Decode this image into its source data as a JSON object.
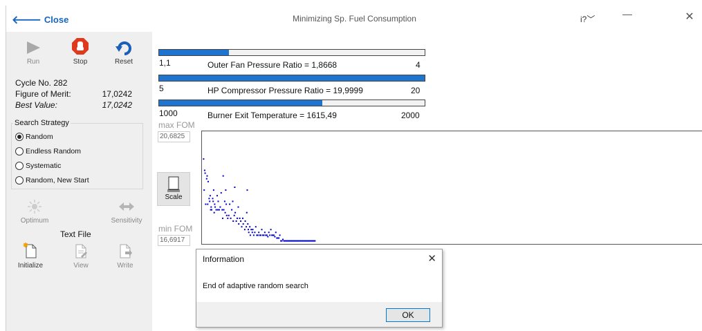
{
  "titlebar": {
    "back_label": "Close",
    "title": "Minimizing Sp. Fuel Consumption",
    "help": "i?",
    "min": "—",
    "close": "✕"
  },
  "toolbar": {
    "run": "Run",
    "stop": "Stop",
    "reset": "Reset"
  },
  "status": {
    "cycle": "Cycle No. 282",
    "fom_label": "Figure of Merit:",
    "fom_value": "17,0242",
    "best_label": "Best Value:",
    "best_value": "17,0242"
  },
  "search_strategy": {
    "legend": "Search Strategy",
    "options": [
      "Random",
      "Endless Random",
      "Systematic",
      "Random, New Start"
    ],
    "selected": "Random"
  },
  "tools": {
    "optimum": "Optimum",
    "sensitivity": "Sensitivity",
    "text_file": "Text File",
    "initialize": "Initialize",
    "view": "View",
    "write": "Write"
  },
  "params": [
    {
      "min": "1,1",
      "label": "Outer Fan Pressure Ratio = 1,8668",
      "max": "4",
      "fill": 0.263
    },
    {
      "min": "5",
      "label": "HP Compressor Pressure Ratio = 19,9999",
      "max": "20",
      "fill": 1.0
    },
    {
      "min": "1000",
      "label": "Burner Exit Temperature = 1615,49",
      "max": "2000",
      "fill": 0.615
    }
  ],
  "plot": {
    "max_label": "max FOM",
    "max_value": "20,6825",
    "min_label": "min FOM",
    "min_value": "16,6917",
    "scale": "Scale"
  },
  "dialog": {
    "title": "Information",
    "message": "End of adaptive random search",
    "ok": "OK"
  },
  "chart_data": {
    "type": "scatter",
    "title": "",
    "xlabel": "",
    "ylabel": "",
    "ylim": [
      16.6917,
      20.6825
    ],
    "xlim": [
      0,
      1000
    ],
    "color": "#0000cc",
    "points": [
      [
        2,
        19.7
      ],
      [
        3,
        18.6
      ],
      [
        4,
        19.3
      ],
      [
        5,
        19.2
      ],
      [
        6,
        18.1
      ],
      [
        8,
        19.0
      ],
      [
        9,
        19.1
      ],
      [
        10,
        18.1
      ],
      [
        11,
        18.9
      ],
      [
        13,
        18.3
      ],
      [
        14,
        18.2
      ],
      [
        15,
        18.4
      ],
      [
        16,
        17.9
      ],
      [
        17,
        18.0
      ],
      [
        18,
        17.9
      ],
      [
        20,
        18.3
      ],
      [
        21,
        18.2
      ],
      [
        22,
        18.6
      ],
      [
        23,
        17.8
      ],
      [
        24,
        18.1
      ],
      [
        25,
        18.0
      ],
      [
        27,
        17.9
      ],
      [
        29,
        18.4
      ],
      [
        30,
        17.9
      ],
      [
        31,
        18.2
      ],
      [
        33,
        17.9
      ],
      [
        35,
        18.0
      ],
      [
        37,
        18.5
      ],
      [
        39,
        17.9
      ],
      [
        40,
        17.6
      ],
      [
        41,
        19.1
      ],
      [
        42,
        17.9
      ],
      [
        44,
        18.2
      ],
      [
        45,
        17.8
      ],
      [
        46,
        18.6
      ],
      [
        47,
        18.1
      ],
      [
        48,
        17.7
      ],
      [
        50,
        17.6
      ],
      [
        52,
        17.7
      ],
      [
        54,
        18.1
      ],
      [
        56,
        17.6
      ],
      [
        58,
        17.9
      ],
      [
        60,
        18.2
      ],
      [
        61,
        17.5
      ],
      [
        63,
        17.7
      ],
      [
        64,
        18.7
      ],
      [
        65,
        17.8
      ],
      [
        67,
        17.5
      ],
      [
        69,
        17.6
      ],
      [
        71,
        18.0
      ],
      [
        72,
        17.4
      ],
      [
        74,
        17.6
      ],
      [
        76,
        17.5
      ],
      [
        78,
        17.3
      ],
      [
        80,
        17.6
      ],
      [
        81,
        17.4
      ],
      [
        84,
        17.2
      ],
      [
        85,
        17.5
      ],
      [
        87,
        17.3
      ],
      [
        88,
        17.8
      ],
      [
        89,
        18.6
      ],
      [
        90,
        17.4
      ],
      [
        91,
        17.2
      ],
      [
        92,
        17.1
      ],
      [
        94,
        17.3
      ],
      [
        95,
        17.0
      ],
      [
        97,
        17.2
      ],
      [
        99,
        17.1
      ],
      [
        100,
        17.2
      ],
      [
        102,
        17.0
      ],
      [
        104,
        17.1
      ],
      [
        106,
        17.3
      ],
      [
        108,
        17.0
      ],
      [
        110,
        17.0
      ],
      [
        112,
        17.1
      ],
      [
        114,
        17.0
      ],
      [
        116,
        17.0
      ],
      [
        118,
        17.2
      ],
      [
        120,
        17.0
      ],
      [
        122,
        17.0
      ],
      [
        124,
        17.1
      ],
      [
        126,
        17.0
      ],
      [
        128,
        17.0
      ],
      [
        130,
        16.95
      ],
      [
        132,
        17.1
      ],
      [
        134,
        17.0
      ],
      [
        136,
        17.2
      ],
      [
        138,
        17.0
      ],
      [
        140,
        17.0
      ],
      [
        142,
        17.0
      ],
      [
        144,
        16.95
      ],
      [
        146,
        17.1
      ],
      [
        148,
        16.9
      ],
      [
        150,
        16.9
      ],
      [
        152,
        16.9
      ],
      [
        154,
        17.0
      ],
      [
        156,
        16.8
      ],
      [
        158,
        16.8
      ],
      [
        160,
        16.85
      ],
      [
        162,
        16.8
      ],
      [
        164,
        16.8
      ],
      [
        166,
        16.8
      ],
      [
        168,
        16.8
      ],
      [
        170,
        16.8
      ],
      [
        172,
        16.8
      ],
      [
        174,
        16.8
      ],
      [
        176,
        16.8
      ],
      [
        178,
        16.8
      ],
      [
        180,
        16.8
      ],
      [
        182,
        16.8
      ],
      [
        184,
        16.8
      ],
      [
        186,
        16.8
      ],
      [
        188,
        16.8
      ],
      [
        190,
        16.8
      ],
      [
        192,
        16.8
      ],
      [
        194,
        16.8
      ],
      [
        196,
        16.8
      ],
      [
        198,
        16.8
      ],
      [
        200,
        16.8
      ],
      [
        202,
        16.8
      ],
      [
        204,
        16.8
      ],
      [
        206,
        16.8
      ],
      [
        208,
        16.8
      ],
      [
        210,
        16.8
      ],
      [
        212,
        16.8
      ],
      [
        214,
        16.8
      ],
      [
        216,
        16.8
      ],
      [
        218,
        16.8
      ],
      [
        220,
        16.8
      ],
      [
        222,
        16.8
      ],
      [
        224,
        16.8
      ]
    ]
  }
}
